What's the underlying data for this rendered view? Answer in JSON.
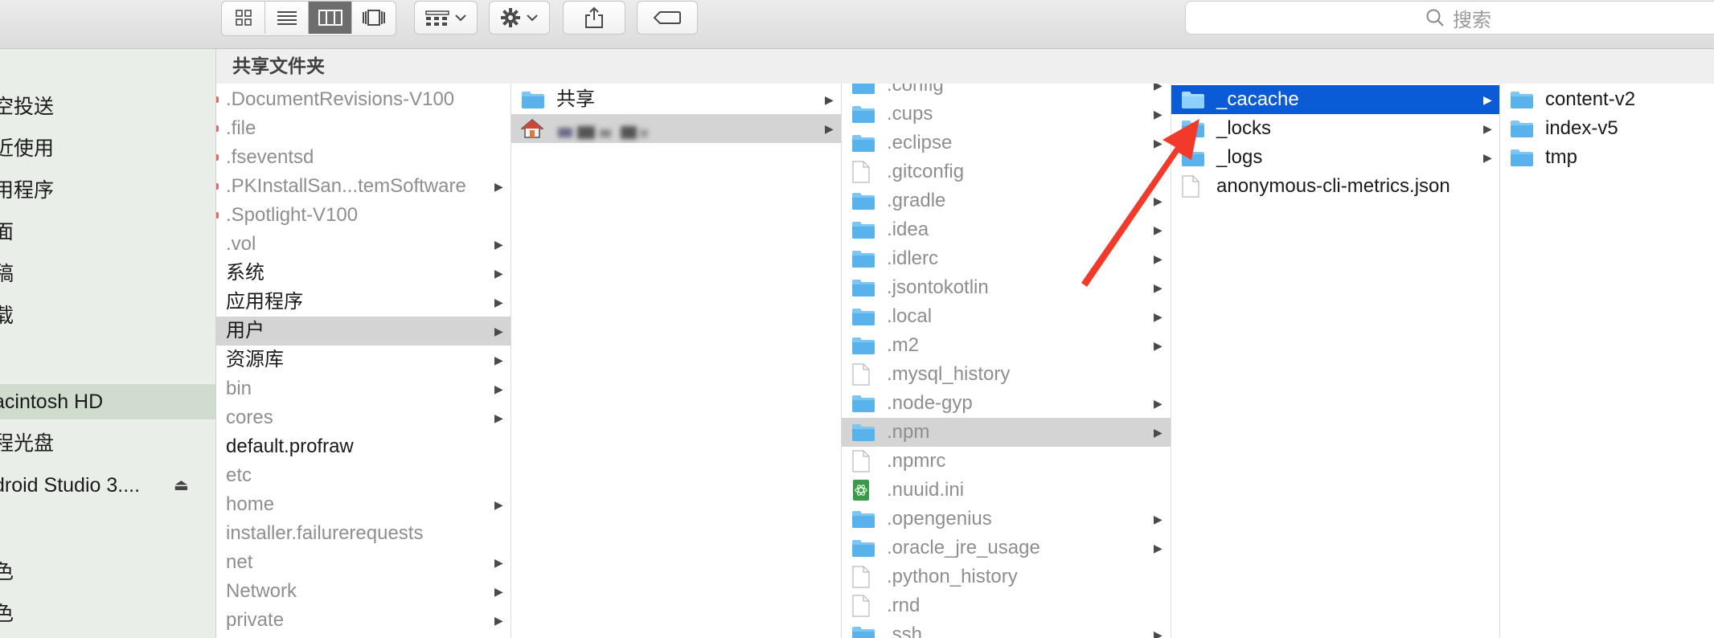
{
  "toolbar": {
    "view_buttons": [
      "icon-view",
      "list-view",
      "column-view",
      "cover-flow-view"
    ],
    "active_view_index": 2,
    "search_placeholder": "搜索"
  },
  "pathbar": {
    "title": "共享文件夹"
  },
  "sidebar": {
    "items": [
      {
        "label": "空投送"
      },
      {
        "label": "近使用"
      },
      {
        "label": "用程序"
      },
      {
        "label": "面"
      },
      {
        "label": "稿"
      },
      {
        "label": "载"
      },
      {
        "label": ""
      },
      {
        "label": "acintosh HD",
        "selected": true
      },
      {
        "label": "程光盘"
      },
      {
        "label": "droid Studio 3...."
      },
      {
        "label": ""
      },
      {
        "label": "色"
      },
      {
        "label": "色"
      }
    ]
  },
  "columns": {
    "root": [
      {
        "label": ".DocumentRevisions-V100",
        "dim": true
      },
      {
        "label": ".file",
        "dim": true
      },
      {
        "label": ".fseventsd",
        "dim": true
      },
      {
        "label": ".PKInstallSan...temSoftware",
        "dim": true,
        "arrow": true
      },
      {
        "label": ".Spotlight-V100",
        "dim": true
      },
      {
        "label": ".vol",
        "dim": true,
        "arrow": true
      },
      {
        "label": "系统",
        "arrow": true
      },
      {
        "label": "应用程序",
        "arrow": true
      },
      {
        "label": "用户",
        "arrow": true,
        "selected": true
      },
      {
        "label": "资源库",
        "arrow": true
      },
      {
        "label": "bin",
        "dim": true,
        "arrow": true
      },
      {
        "label": "cores",
        "dim": true,
        "arrow": true
      },
      {
        "label": "default.profraw"
      },
      {
        "label": "etc",
        "dim": true
      },
      {
        "label": "home",
        "dim": true,
        "arrow": true
      },
      {
        "label": "installer.failurerequests",
        "dim": true
      },
      {
        "label": "net",
        "dim": true,
        "arrow": true
      },
      {
        "label": "Network",
        "dim": true,
        "arrow": true
      },
      {
        "label": "private",
        "dim": true,
        "arrow": true
      }
    ],
    "users": [
      {
        "label": "共享",
        "icon": "folder-icon",
        "arrow": true
      },
      {
        "label": "",
        "icon": "home-icon",
        "arrow": true,
        "selected": true,
        "blurred": true
      }
    ],
    "home": [
      {
        "label": ".config",
        "icon": "folder-icon",
        "dim": true,
        "arrow": true
      },
      {
        "label": ".cups",
        "icon": "folder-icon",
        "dim": true,
        "arrow": true
      },
      {
        "label": ".eclipse",
        "icon": "folder-icon",
        "dim": true,
        "arrow": true
      },
      {
        "label": ".gitconfig",
        "icon": "file-icon",
        "dim": true
      },
      {
        "label": ".gradle",
        "icon": "folder-icon",
        "dim": true,
        "arrow": true
      },
      {
        "label": ".idea",
        "icon": "folder-icon",
        "dim": true,
        "arrow": true
      },
      {
        "label": ".idlerc",
        "icon": "folder-icon",
        "dim": true,
        "arrow": true
      },
      {
        "label": ".jsontokotlin",
        "icon": "folder-icon",
        "dim": true,
        "arrow": true
      },
      {
        "label": ".local",
        "icon": "folder-icon",
        "dim": true,
        "arrow": true
      },
      {
        "label": ".m2",
        "icon": "folder-icon",
        "dim": true,
        "arrow": true
      },
      {
        "label": ".mysql_history",
        "icon": "file-icon",
        "dim": true
      },
      {
        "label": ".node-gyp",
        "icon": "folder-icon",
        "dim": true,
        "arrow": true
      },
      {
        "label": ".npm",
        "icon": "folder-icon",
        "dim": true,
        "arrow": true,
        "selected": true
      },
      {
        "label": ".npmrc",
        "icon": "file-icon",
        "dim": true
      },
      {
        "label": ".nuuid.ini",
        "icon": "ini-file-icon",
        "dim": true
      },
      {
        "label": ".opengenius",
        "icon": "folder-icon",
        "dim": true,
        "arrow": true
      },
      {
        "label": ".oracle_jre_usage",
        "icon": "folder-icon",
        "dim": true,
        "arrow": true
      },
      {
        "label": ".python_history",
        "icon": "file-icon",
        "dim": true
      },
      {
        "label": ".rnd",
        "icon": "file-icon",
        "dim": true
      },
      {
        "label": ".ssh",
        "icon": "folder-icon",
        "dim": true,
        "arrow": true
      }
    ],
    "npm": [
      {
        "label": "_cacache",
        "icon": "folder-icon",
        "arrow": true,
        "selected": true
      },
      {
        "label": "_locks",
        "icon": "folder-icon",
        "arrow": true
      },
      {
        "label": "_logs",
        "icon": "folder-icon",
        "arrow": true
      },
      {
        "label": "anonymous-cli-metrics.json",
        "icon": "file-icon"
      }
    ],
    "cacache": [
      {
        "label": "content-v2",
        "icon": "folder-icon"
      },
      {
        "label": "index-v5",
        "icon": "folder-icon"
      },
      {
        "label": "tmp",
        "icon": "folder-icon"
      }
    ]
  },
  "annotation": {
    "color": "#f23a2a"
  }
}
